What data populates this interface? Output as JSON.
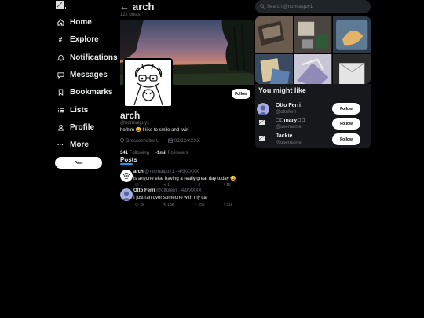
{
  "nav": {
    "items": [
      {
        "label": "Home",
        "icon": "home-icon"
      },
      {
        "label": "Explore",
        "icon": "hashtag-icon"
      },
      {
        "label": "Notifications",
        "icon": "bell-icon"
      },
      {
        "label": "Messages",
        "icon": "message-icon"
      },
      {
        "label": "Bookmarks",
        "icon": "bookmark-icon"
      },
      {
        "label": "Lists",
        "icon": "list-icon"
      },
      {
        "label": "Profile",
        "icon": "person-icon"
      },
      {
        "label": "More",
        "icon": "more-icon"
      }
    ],
    "post_label": "Post"
  },
  "header": {
    "back": "←",
    "title": "arch",
    "post_count": "12k posts"
  },
  "profile": {
    "follow_label": "Follow",
    "name": "arch",
    "handle": "@normalguy1",
    "bio": "he/him 😀 I like to smile and twirl",
    "location": "Gressenheller U",
    "joined": "02/12/XXXX",
    "following_count": "341",
    "following_label": "Following",
    "followers_count": "-1mil",
    "followers_label": "Followers"
  },
  "tabs": {
    "posts": "Posts"
  },
  "tweets": [
    {
      "name": "arch",
      "handle": "@normalguy1",
      "date": "· 4/9/XXXX",
      "text": "is anyone else having a really great day today 😀",
      "replies": "1",
      "retweets": "1",
      "likes": "2",
      "views": "15"
    },
    {
      "name": "Otto Ferri",
      "handle": "@ottofern",
      "date": "· 4/9/XXXX",
      "text": "I just ran over someone with my car",
      "replies": "2k",
      "retweets": "13k",
      "likes": "25k",
      "views": "51k"
    }
  ],
  "search": {
    "placeholder": "Search @normalguy1"
  },
  "who_to_follow": {
    "title": "You might like",
    "button_label": "Follow",
    "users": [
      {
        "name": "Otto Ferri",
        "handle": "@ottofern"
      },
      {
        "name": "⃝⃝mary⃝⃝",
        "handle": "@username"
      },
      {
        "name": "Jackie",
        "handle": "@username"
      }
    ]
  },
  "colors": {
    "accent": "#1d9bf0",
    "background": "#000000",
    "secondary_text": "#71767b",
    "panel": "#16181c"
  }
}
